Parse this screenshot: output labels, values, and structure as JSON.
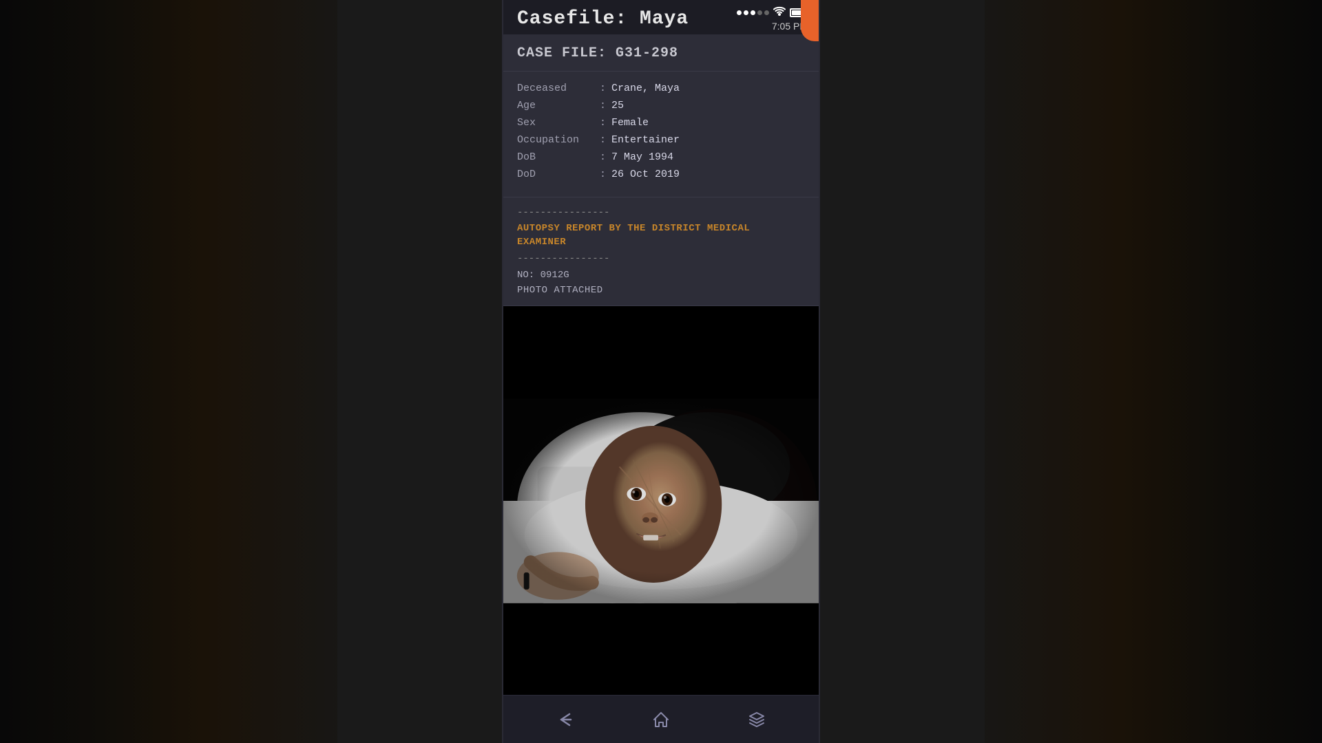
{
  "app": {
    "title": "Casefile: Maya",
    "time": "7:05 PM",
    "battery_level": "85"
  },
  "status_bar": {
    "signal_dots": 5,
    "signal_active": 3,
    "time": "7:05 PM"
  },
  "case_file": {
    "header_title": "CASE FILE: G31-298",
    "fields": [
      {
        "label": "Deceased",
        "separator": ":",
        "value": "Crane, Maya"
      },
      {
        "label": "Age",
        "separator": ":",
        "value": "25"
      },
      {
        "label": "Sex",
        "separator": ":",
        "value": "Female"
      },
      {
        "label": "Occupation",
        "separator": ":",
        "value": "Entertainer"
      },
      {
        "label": "DoB",
        "separator": ":",
        "value": "7 May 1994"
      },
      {
        "label": "DoD",
        "separator": ":",
        "value": "26 Oct 2019"
      }
    ],
    "divider": "----------------",
    "autopsy_title": "AUTOPSY REPORT BY THE DISTRICT MEDICAL EXAMINER",
    "autopsy_divider": "----------------",
    "report_no_label": "NO:",
    "report_no": "0912G",
    "photo_label": "PHOTO ATTACHED"
  },
  "nav": {
    "back_label": "back",
    "home_label": "home",
    "menu_label": "menu"
  }
}
